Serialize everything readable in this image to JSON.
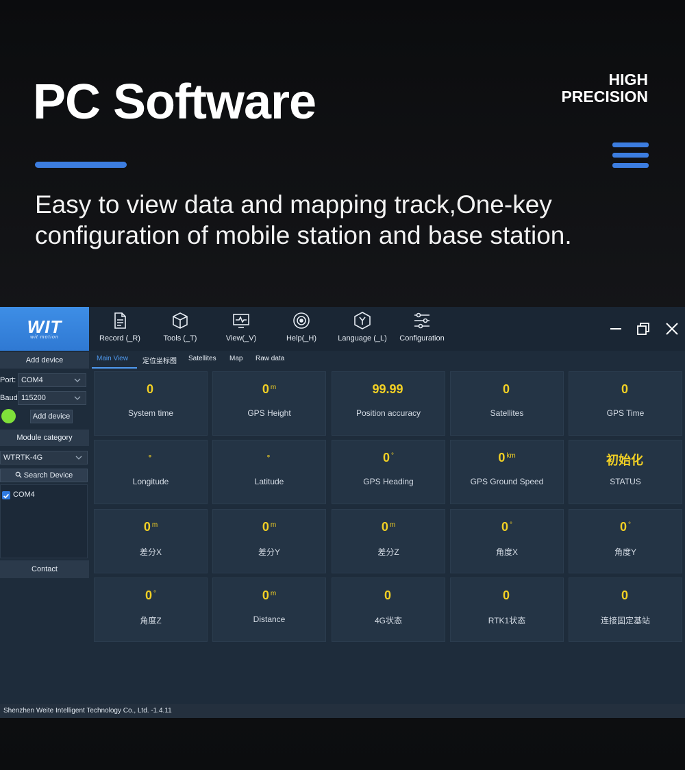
{
  "hero": {
    "title": "PC Software",
    "badge_line1": "HIGH",
    "badge_line2": "PRECISION",
    "description": "Easy to view data and mapping track,One-key configuration of mobile station and base station."
  },
  "colors": {
    "accent": "#3c7de0",
    "value_yellow": "#f2d024",
    "status_green": "#7fe03a",
    "logo_blue": "#3a88e3"
  },
  "app": {
    "logo": {
      "mark": "WIT",
      "sub": "wit motion"
    },
    "toolbar": [
      {
        "label": "Record (_R)",
        "icon": "document-icon"
      },
      {
        "label": "Tools (_T)",
        "icon": "cube-icon"
      },
      {
        "label": "View(_V)",
        "icon": "monitor-icon"
      },
      {
        "label": "Help(_H)",
        "icon": "target-icon"
      },
      {
        "label": "Language (_L)",
        "icon": "language-icon"
      },
      {
        "label": "Configuration",
        "icon": "sliders-icon"
      }
    ],
    "sidebar": {
      "add_device_header": "Add device",
      "port_label": "Port:",
      "port_value": "COM4",
      "baud_label": "Baud:",
      "baud_value": "115200",
      "add_device_button": "Add device",
      "module_category_header": "Module category",
      "module_value": "WTRTK-4G",
      "search_button": "Search Device",
      "device_item": "COM4",
      "contact_header": "Contact"
    },
    "tabs": [
      "Main View",
      "定位坐标图",
      "Satellites",
      "Map",
      "Raw data"
    ],
    "cells": [
      {
        "value": "0",
        "unit": "",
        "label": "System time"
      },
      {
        "value": "0",
        "unit": "m",
        "label": "GPS Height"
      },
      {
        "value": "99.99",
        "unit": "",
        "label": "Position accuracy"
      },
      {
        "value": "0",
        "unit": "",
        "label": "Satellites"
      },
      {
        "value": "0",
        "unit": "",
        "label": "GPS Time"
      },
      {
        "value": "°",
        "unit": "",
        "label": "Longitude"
      },
      {
        "value": "°",
        "unit": "",
        "label": "Latitude"
      },
      {
        "value": "0",
        "unit": "°",
        "label": "GPS Heading"
      },
      {
        "value": "0",
        "unit": "km",
        "label": "GPS Ground Speed"
      },
      {
        "value": "初始化",
        "unit": "",
        "label": "STATUS"
      },
      {
        "value": "0",
        "unit": "m",
        "label": "差分X"
      },
      {
        "value": "0",
        "unit": "m",
        "label": "差分Y"
      },
      {
        "value": "0",
        "unit": "m",
        "label": "差分Z"
      },
      {
        "value": "0",
        "unit": "°",
        "label": "角度X"
      },
      {
        "value": "0",
        "unit": "°",
        "label": "角度Y"
      },
      {
        "value": "0",
        "unit": "°",
        "label": "角度Z"
      },
      {
        "value": "0",
        "unit": "m",
        "label": "Distance"
      },
      {
        "value": "0",
        "unit": "",
        "label": "4G状态"
      },
      {
        "value": "0",
        "unit": "",
        "label": "RTK1状态"
      },
      {
        "value": "0",
        "unit": "",
        "label": "连接固定基站"
      }
    ],
    "statusbar": "Shenzhen Weite Intelligent Technology Co., Ltd. -1.4.11"
  }
}
